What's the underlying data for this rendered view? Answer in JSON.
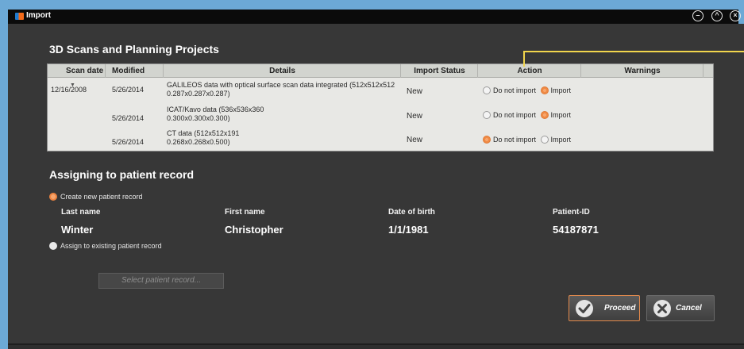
{
  "window": {
    "title": "Import",
    "controls": [
      "minimize-icon",
      "restore-icon",
      "close-icon"
    ]
  },
  "scans_section": {
    "title": "3D Scans and Planning Projects",
    "columns": [
      "Scan date",
      "Modified",
      "Details",
      "Import Status",
      "Action",
      "Warnings"
    ],
    "rows": [
      {
        "scan_date": "12/16/2008",
        "modified": "5/26/2014",
        "details_line1": "GALILEOS data with optical surface scan data integrated (512x512x512",
        "details_line2": "0.287x0.287x0.287)",
        "status": "New",
        "action_selected": "Import"
      },
      {
        "scan_date": "",
        "modified": "5/26/2014",
        "details_line1": "ICAT/Kavo data (536x536x360",
        "details_line2": "0.300x0.300x0.300)",
        "status": "New",
        "action_selected": "Import"
      },
      {
        "scan_date": "",
        "modified": "5/26/2014",
        "details_line1": "CT data (512x512x191",
        "details_line2": "0.268x0.268x0.500)",
        "status": "New",
        "action_selected": "Do not import"
      }
    ],
    "action_options": [
      "Do not import",
      "Import"
    ]
  },
  "assign_section": {
    "title": "Assigning to patient record",
    "option_new": "Create new patient record",
    "option_existing": "Assign to existing patient record",
    "selected": "Create new patient record",
    "fields": {
      "last_name_label": "Last name",
      "first_name_label": "First name",
      "dob_label": "Date of birth",
      "patient_id_label": "Patient-ID",
      "last_name": "Winter",
      "first_name": "Christopher",
      "dob": "1/1/1981",
      "patient_id": "54187871"
    },
    "select_record_label": "Select patient record..."
  },
  "buttons": {
    "proceed": "Proceed",
    "cancel": "Cancel"
  },
  "colors": {
    "accent_orange": "#f08a45",
    "callout_yellow": "#f1d54c",
    "titlebar_blue": "#6ca9d6"
  }
}
